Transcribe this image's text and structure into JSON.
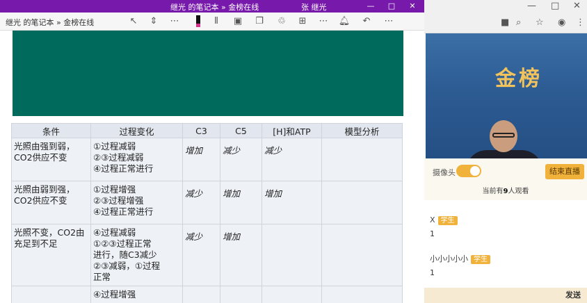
{
  "onenote": {
    "window_title": "继光 的笔记本 » 金榜在线",
    "user_name": "张 继光",
    "breadcrumb": "继光 的笔记本 » 金榜在线"
  },
  "table": {
    "headers": [
      "条件",
      "过程变化",
      "C3",
      "C5",
      "[H]和ATP",
      "模型分析"
    ],
    "rows": [
      {
        "condition": "光照由强到弱，CO2供应不变",
        "process": [
          "①过程减弱",
          "②③过程减弱",
          "④过程正常进行"
        ],
        "c3": "增加",
        "c5": "减少",
        "h_atp": "减少",
        "model": ""
      },
      {
        "condition": "光照由弱到强，CO2供应不变",
        "process": [
          "①过程增强",
          "②③过程增强",
          "④过程正常进行"
        ],
        "c3": "减少",
        "c5": "增加",
        "h_atp": "增加",
        "model": ""
      },
      {
        "condition": "光照不变，CO2由充足到不足",
        "process": [
          "④过程减弱",
          "①②③过程正常",
          "进行，随C3减少",
          "②③减弱，①过程",
          "正常"
        ],
        "c3": "减少",
        "c5": "增加",
        "h_atp": "",
        "model": ""
      },
      {
        "condition": "",
        "process": [
          "④过程增强"
        ],
        "c3": "",
        "c5": "",
        "h_atp": "",
        "model": ""
      }
    ]
  },
  "live": {
    "camera_label": "摄像头",
    "camera_on": true,
    "end_button": "结束直播",
    "viewers_prefix": "当前有",
    "viewers_count": "9",
    "viewers_suffix": "人观看",
    "messages": [
      {
        "name": "X",
        "tag": "学生",
        "text": "1"
      },
      {
        "name": "小小小小小",
        "tag": "学生",
        "text": "1"
      }
    ],
    "send_label": "发送",
    "video_logo": "金榜"
  },
  "colors": {
    "onenote_purple": "#7719aa",
    "teal_block": "#006a5c",
    "accent_orange": "#f0b23a"
  }
}
